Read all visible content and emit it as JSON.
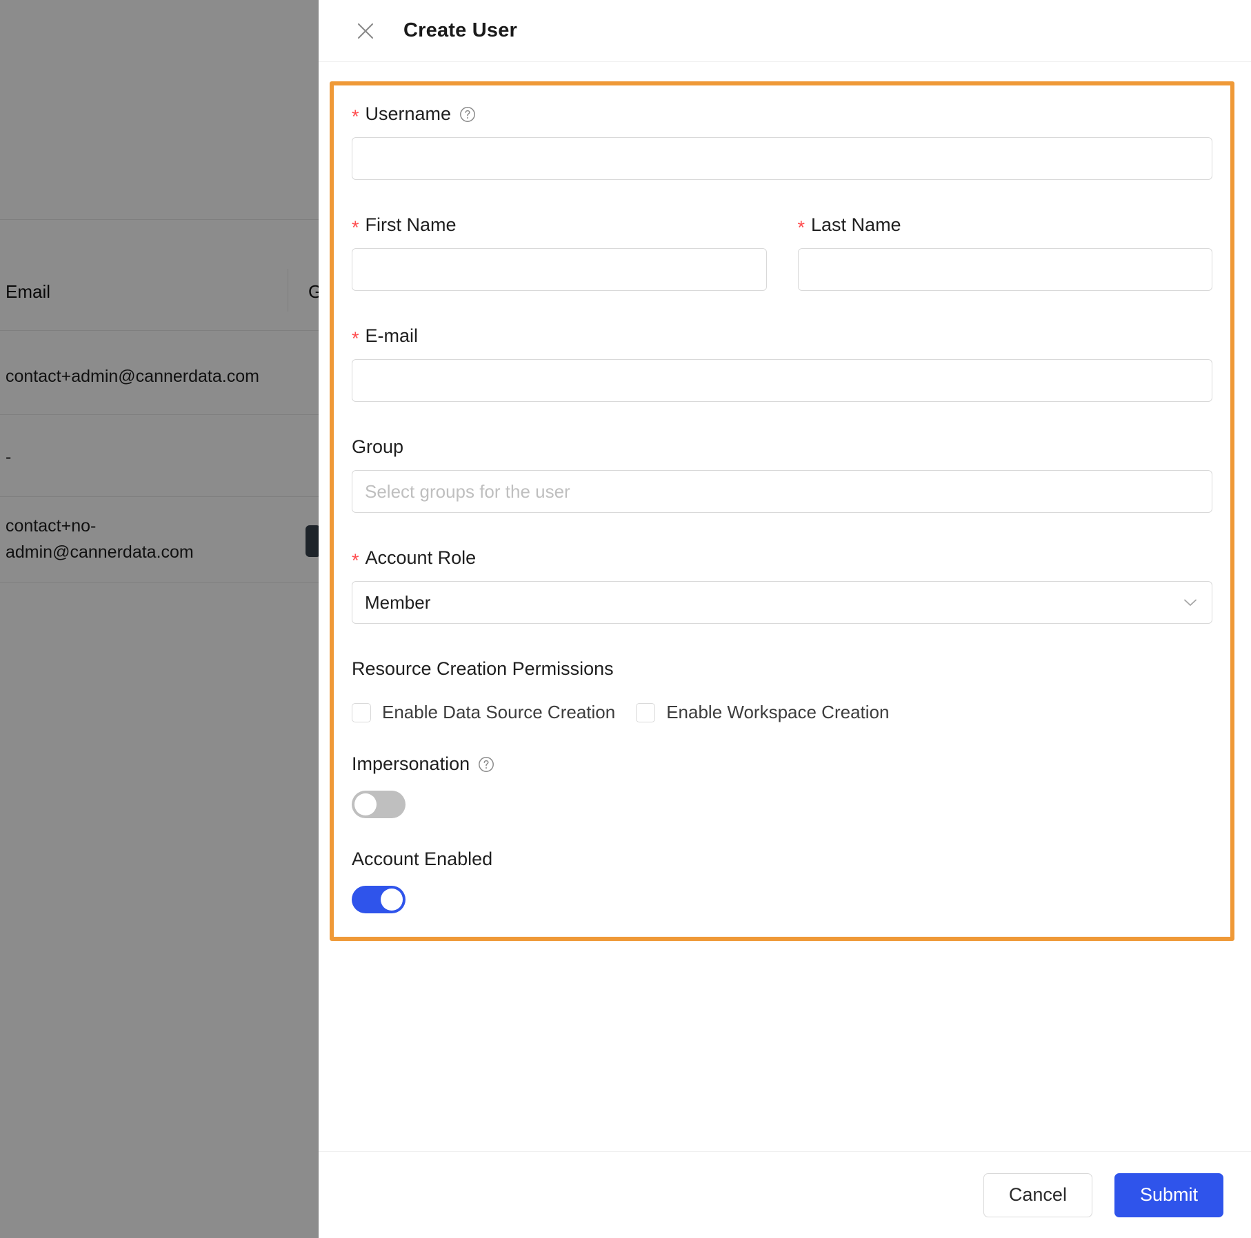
{
  "background": {
    "columns": [
      "Email",
      "G"
    ],
    "rows": [
      {
        "email": "contact+admin@cannerdata.com"
      },
      {
        "email": "-"
      },
      {
        "email": "contact+no-\nadmin@cannerdata.com"
      }
    ]
  },
  "drawer": {
    "title": "Create User",
    "close_icon": "close-icon"
  },
  "form": {
    "username": {
      "label": "Username",
      "required_mark": "*",
      "value": "",
      "placeholder": "",
      "help_icon": "question-circle-icon"
    },
    "first_name": {
      "label": "First Name",
      "required_mark": "*",
      "value": "",
      "placeholder": ""
    },
    "last_name": {
      "label": "Last Name",
      "required_mark": "*",
      "value": "",
      "placeholder": ""
    },
    "email": {
      "label": "E-mail",
      "required_mark": "*",
      "value": "",
      "placeholder": ""
    },
    "group": {
      "label": "Group",
      "value": "",
      "placeholder": "Select groups for the user"
    },
    "account_role": {
      "label": "Account Role",
      "required_mark": "*",
      "selected": "Member",
      "options": [
        "Member"
      ],
      "chevron_icon": "chevron-down-icon"
    },
    "resource_permissions": {
      "title": "Resource Creation Permissions",
      "checkboxes": [
        {
          "label": "Enable Data Source Creation",
          "checked": false
        },
        {
          "label": "Enable Workspace Creation",
          "checked": false
        }
      ]
    },
    "impersonation": {
      "label": "Impersonation",
      "help_icon": "question-circle-icon",
      "enabled": false
    },
    "account_enabled": {
      "label": "Account Enabled",
      "enabled": true
    }
  },
  "footer": {
    "cancel_label": "Cancel",
    "submit_label": "Submit"
  },
  "colors": {
    "highlight": "#ef9937",
    "primary": "#2f54eb",
    "required": "#ff4d4f",
    "toggle_off": "#bfbfbf"
  }
}
